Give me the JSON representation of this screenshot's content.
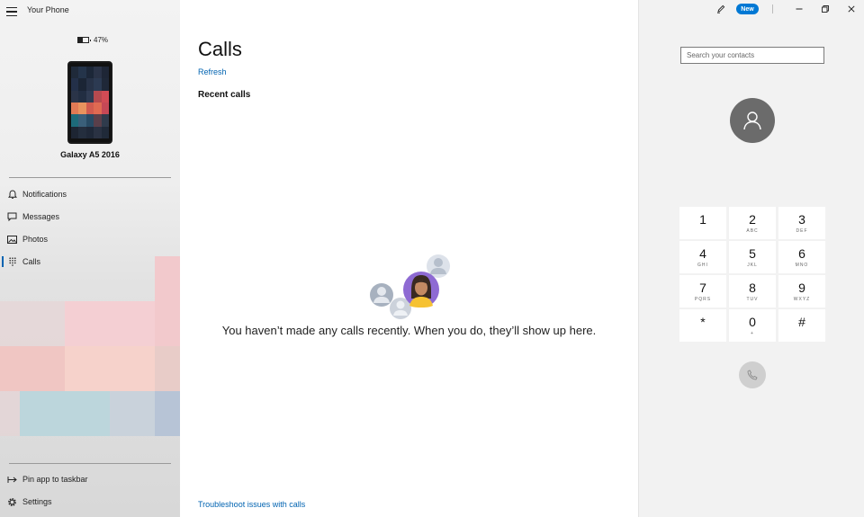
{
  "app": {
    "title": "Your Phone"
  },
  "device": {
    "battery": "47%",
    "battery_level": 0.47,
    "name": "Galaxy A5 2016"
  },
  "nav": {
    "items": [
      {
        "label": "Notifications",
        "icon": "bell-icon"
      },
      {
        "label": "Messages",
        "icon": "message-icon"
      },
      {
        "label": "Photos",
        "icon": "photo-icon"
      },
      {
        "label": "Calls",
        "icon": "dialpad-icon",
        "active": true
      }
    ],
    "footer": [
      {
        "label": "Pin app to taskbar",
        "icon": "pin-icon"
      },
      {
        "label": "Settings",
        "icon": "gear-icon"
      }
    ]
  },
  "main": {
    "title": "Calls",
    "refresh": "Refresh",
    "section": "Recent calls",
    "empty_message": "You haven’t made any calls recently. When you do, they’ll show up here.",
    "troubleshoot": "Troubleshoot issues with calls"
  },
  "titlebar": {
    "new_badge": "New"
  },
  "dialer": {
    "search_placeholder": "Search your contacts",
    "keys": [
      {
        "digit": "1",
        "letters": ""
      },
      {
        "digit": "2",
        "letters": "ABC"
      },
      {
        "digit": "3",
        "letters": "DEF"
      },
      {
        "digit": "4",
        "letters": "GHI"
      },
      {
        "digit": "5",
        "letters": "JKL"
      },
      {
        "digit": "6",
        "letters": "MNO"
      },
      {
        "digit": "7",
        "letters": "PQRS"
      },
      {
        "digit": "8",
        "letters": "TUV"
      },
      {
        "digit": "9",
        "letters": "WXYZ"
      },
      {
        "digit": "*",
        "letters": ""
      },
      {
        "digit": "0",
        "letters": "+"
      },
      {
        "digit": "#",
        "letters": ""
      }
    ]
  },
  "colors": {
    "accent": "#0063b1",
    "badge": "#0078d4",
    "avatar": "#6b6b6b"
  }
}
